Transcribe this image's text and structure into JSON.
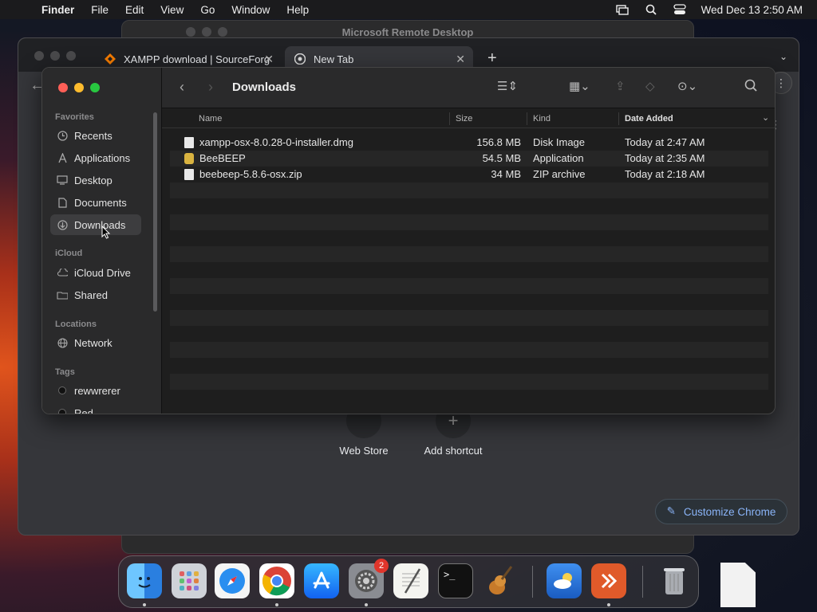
{
  "menubar": {
    "app_name": "Finder",
    "items": [
      "File",
      "Edit",
      "View",
      "Go",
      "Window",
      "Help"
    ],
    "clock": "Wed Dec 13  2:50 AM"
  },
  "rdp": {
    "title": "Microsoft Remote Desktop"
  },
  "chrome": {
    "tabs": [
      {
        "label": "XAMPP download | SourceForg",
        "icon": "sourceforge-icon"
      },
      {
        "label": "New Tab",
        "icon": "chrome-icon"
      }
    ],
    "shortcuts": [
      {
        "label": "Web Store"
      },
      {
        "label": "Add shortcut"
      }
    ],
    "customize_label": "Customize Chrome"
  },
  "finder": {
    "title": "Downloads",
    "sidebar": {
      "favorites_header": "Favorites",
      "favorites": [
        "Recents",
        "Applications",
        "Desktop",
        "Documents",
        "Downloads"
      ],
      "icloud_header": "iCloud",
      "icloud": [
        "iCloud Drive",
        "Shared"
      ],
      "locations_header": "Locations",
      "locations": [
        "Network"
      ],
      "tags_header": "Tags",
      "tags": [
        "rewwrerer",
        "Red"
      ]
    },
    "columns": {
      "name": "Name",
      "size": "Size",
      "kind": "Kind",
      "date": "Date Added"
    },
    "files": [
      {
        "name": "xampp-osx-8.0.28-0-installer.dmg",
        "size": "156.8 MB",
        "kind": "Disk Image",
        "date": "Today at 2:47 AM"
      },
      {
        "name": "BeeBEEP",
        "size": "54.5 MB",
        "kind": "Application",
        "date": "Today at 2:35 AM"
      },
      {
        "name": "beebeep-5.8.6-osx.zip",
        "size": "34 MB",
        "kind": "ZIP archive",
        "date": "Today at 2:18 AM"
      }
    ]
  },
  "dock": {
    "system_settings_badge": "2",
    "apps": [
      "finder-icon",
      "launchpad-icon",
      "safari-icon",
      "chrome-icon",
      "app-store-icon",
      "system-settings-icon",
      "textedit-icon",
      "terminal-icon",
      "garageband-icon",
      "weather-icon",
      "remote-desktop-icon",
      "trash-icon"
    ]
  }
}
